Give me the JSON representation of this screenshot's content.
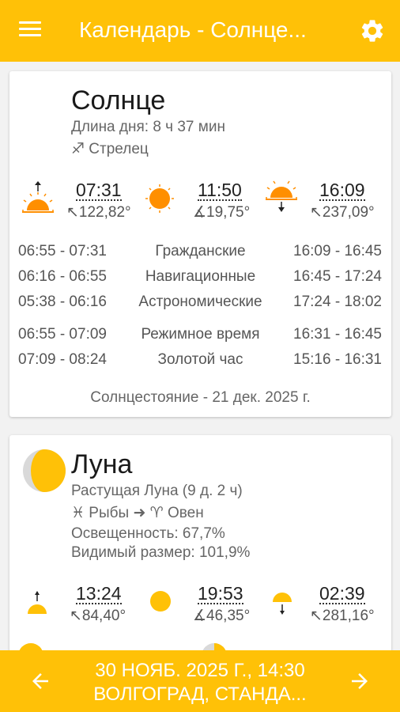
{
  "appbar": {
    "title": "Календарь - Солнце..."
  },
  "sun": {
    "title": "Солнце",
    "day_length": "Длина дня: 8 ч 37 мин",
    "zodiac": "♐ Стрелец",
    "events": {
      "sunrise": {
        "time": "07:31",
        "azimuth": "↖122,82°"
      },
      "noon": {
        "time": "11:50",
        "altitude": "∡19,75°"
      },
      "sunset": {
        "time": "16:09",
        "azimuth": "↖237,09°"
      }
    },
    "twilights": [
      {
        "morning": "06:55 - 07:31",
        "name": "Гражданские",
        "evening": "16:09 - 16:45"
      },
      {
        "morning": "06:16 - 06:55",
        "name": "Навигационные",
        "evening": "16:45 - 17:24"
      },
      {
        "morning": "05:38 - 06:16",
        "name": "Астрономические",
        "evening": "17:24 - 18:02"
      },
      {
        "morning": "06:55 - 07:09",
        "name": "Режимное время",
        "evening": "16:31 - 16:45"
      },
      {
        "morning": "07:09 - 08:24",
        "name": "Золотой час",
        "evening": "15:16 - 16:31"
      }
    ],
    "solstice": "Солнцестояние - 21 дек. 2025 г."
  },
  "moon": {
    "title": "Луна",
    "phase": "Растущая Луна (9 д. 2 ч)",
    "sign": "♓ Рыбы ➜ ♈ Овен",
    "illumination": "Освещенность: 67,7%",
    "size": "Видимый размер: 101,9%",
    "events": {
      "moonrise": {
        "time": "13:24",
        "azimuth": "↖84,40°"
      },
      "culmination": {
        "time": "19:53",
        "altitude": "∡46,35°"
      },
      "moonset": {
        "time": "02:39",
        "azimuth": "↖281,16°"
      }
    }
  },
  "bottom": {
    "date_line": "30 НОЯБ. 2025 Г., 14:30",
    "place_line": "ВОЛГОГРАД, СТАНДА..."
  },
  "colors": {
    "accent": "#ffc107",
    "sun": "#ff8f00",
    "moon": "#ffc107"
  }
}
